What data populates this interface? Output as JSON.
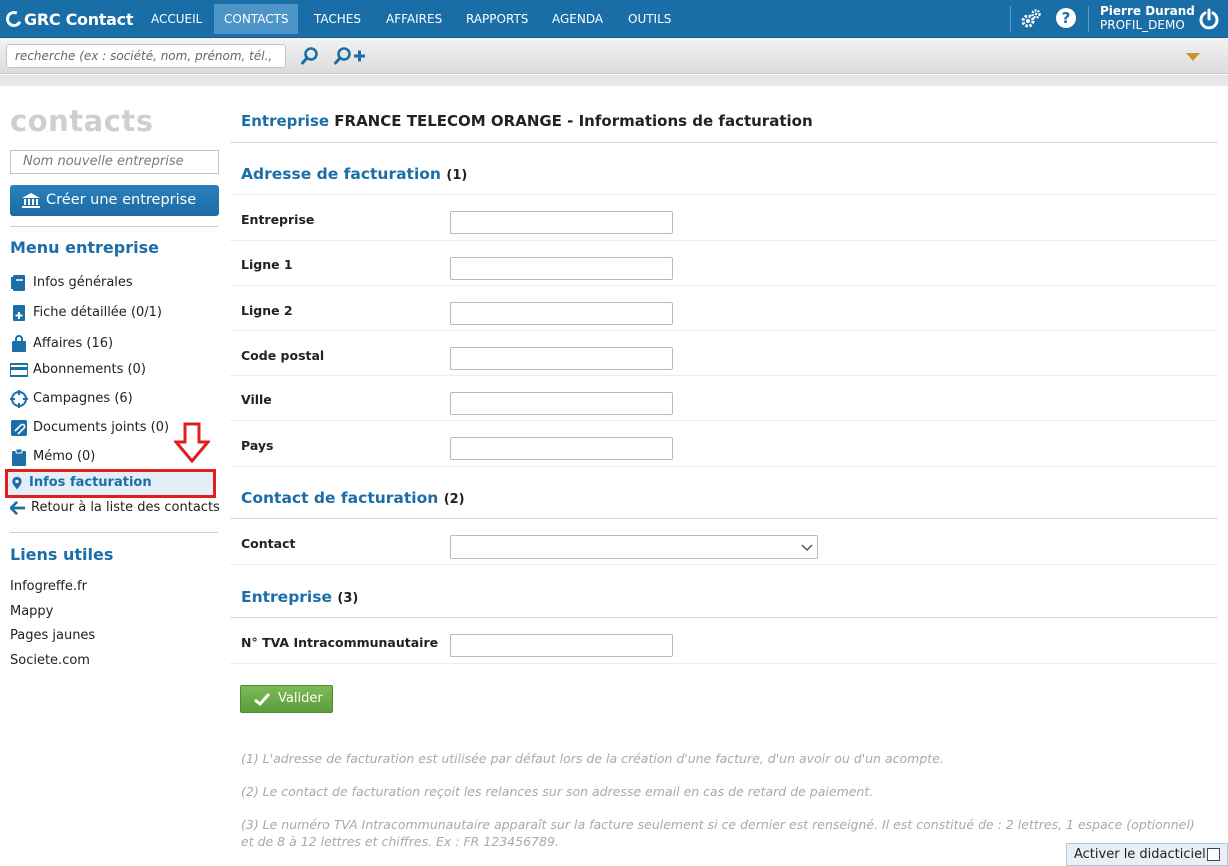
{
  "topnav": {
    "logo": "GRC Contact",
    "items": [
      "ACCUEIL",
      "CONTACTS",
      "TACHES",
      "AFFAIRES",
      "RAPPORTS",
      "AGENDA",
      "OUTILS"
    ],
    "active": "CONTACTS",
    "user_name": "Pierre Durand",
    "user_profile": "PROFIL_DEMO",
    "icons": [
      "settings-gears-icon",
      "help-icon",
      "power-icon"
    ]
  },
  "search": {
    "placeholder": "recherche (ex : société, nom, prénom, tél., e",
    "icons": [
      "search-icon",
      "add-contact-icon",
      "dropdown-triangle-icon"
    ]
  },
  "sidebar": {
    "title": "contacts",
    "new_company_placeholder": "Nom nouvelle entreprise",
    "create_button": "Créer une entreprise",
    "menu_heading": "Menu entreprise",
    "menu": [
      {
        "label": "Infos générales",
        "icon": "document-icon"
      },
      {
        "label": "Fiche détaillée (0/1)",
        "icon": "document-plus-icon"
      },
      {
        "label": "Affaires (16)",
        "icon": "bag-icon"
      },
      {
        "label": "Abonnements (0)",
        "icon": "card-icon"
      },
      {
        "label": "Campagnes (6)",
        "icon": "target-icon"
      },
      {
        "label": "Documents joints (0)",
        "icon": "paperclip-icon"
      },
      {
        "label": "Mémo (0)",
        "icon": "clipboard-icon"
      },
      {
        "label": "Infos facturation",
        "icon": "map-pin-icon"
      },
      {
        "label": "Retour à la liste des contacts",
        "icon": "arrow-left-icon"
      }
    ],
    "active_item": "Infos facturation",
    "links_heading": "Liens utiles",
    "links": [
      "Infogreffe.fr",
      "Mappy",
      "Pages jaunes",
      "Societe.com"
    ]
  },
  "main": {
    "title_prefix": "Entreprise",
    "title_rest": "FRANCE TELECOM ORANGE - Informations de facturation",
    "section1": {
      "title": "Adresse de facturation",
      "num": "(1)"
    },
    "address_fields": [
      "Entreprise",
      "Ligne 1",
      "Ligne 2",
      "Code postal",
      "Ville",
      "Pays"
    ],
    "address_values": [
      "",
      "",
      "",
      "",
      "",
      ""
    ],
    "section2": {
      "title": "Contact de facturation",
      "num": "(2)"
    },
    "contact_label": "Contact",
    "contact_value": "",
    "section3": {
      "title": "Entreprise",
      "num": "(3)"
    },
    "tva_label": "N° TVA Intracommunautaire",
    "tva_value": "",
    "submit": "Valider",
    "notes": [
      "(1) L'adresse de facturation est utilisée par défaut lors de la création d'une facture, d'un avoir ou d'un acompte.",
      "(2) Le contact de facturation reçoit les relances sur son adresse email en cas de retard de paiement.",
      "(3) Le numéro TVA Intracommunautaire apparaît sur la facture seulement si ce dernier est renseigné. Il est constitué de : 2 lettres, 1 espace (optionnel) et de 8 à 12 lettres et chiffres. Ex : FR 123456789."
    ]
  },
  "tutorial": {
    "label": "Activer le didacticiel",
    "checked": false
  },
  "colors": {
    "nav_bg": "#1a6ea7",
    "accent": "#1b6ea8",
    "highlight": "#e02020",
    "valider": "#6aab48"
  }
}
